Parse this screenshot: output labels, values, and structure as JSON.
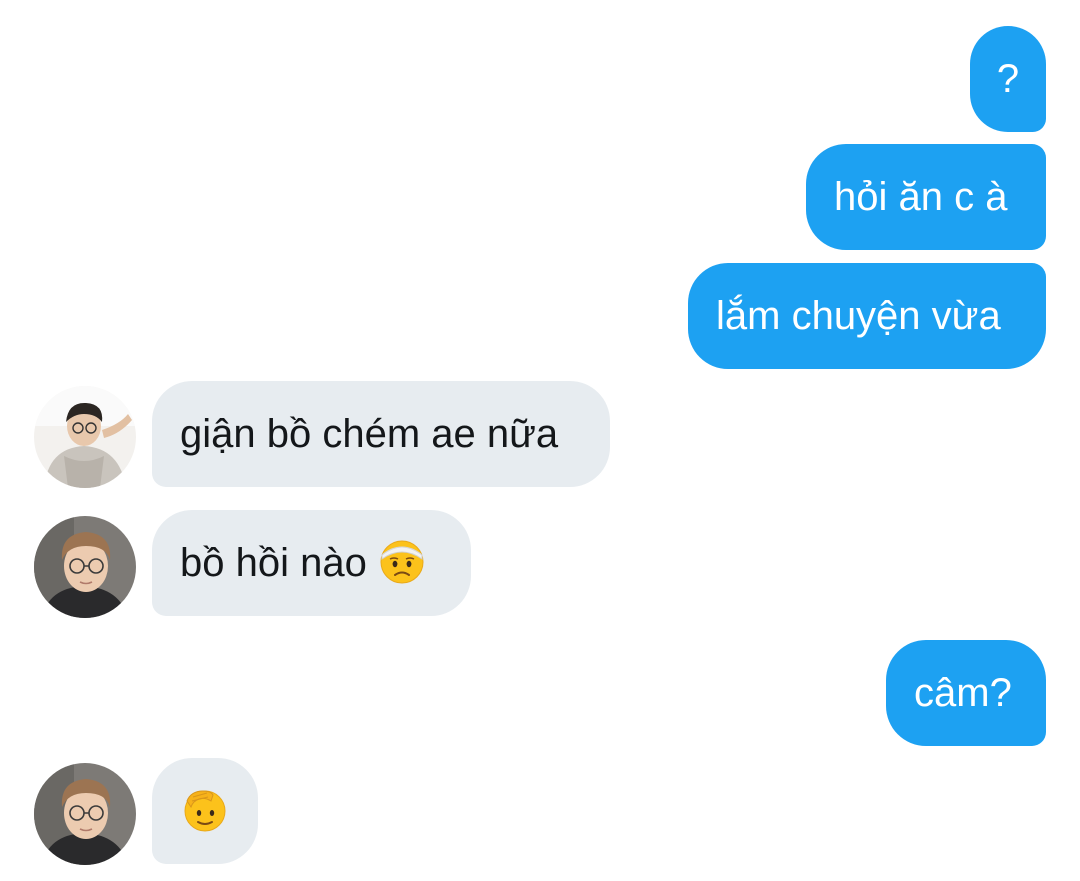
{
  "conversation": {
    "messages": [
      {
        "direction": "outgoing",
        "text": "?"
      },
      {
        "direction": "outgoing",
        "text": "hỏi ăn c à"
      },
      {
        "direction": "outgoing",
        "text": "lắm chuyện vừa"
      },
      {
        "direction": "incoming",
        "text": "giận bồ chém ae nữa"
      },
      {
        "direction": "incoming",
        "text": "bồ hồi nào",
        "emoji": "head-bandage-emoji"
      },
      {
        "direction": "outgoing",
        "text": "câm?"
      },
      {
        "direction": "incoming",
        "text": "",
        "emoji": "saluting-face-emoji"
      }
    ]
  },
  "colors": {
    "outgoing_bubble": "#1da1f2",
    "incoming_bubble": "#e7ecf0",
    "outgoing_text": "#ffffff",
    "incoming_text": "#14171a"
  }
}
